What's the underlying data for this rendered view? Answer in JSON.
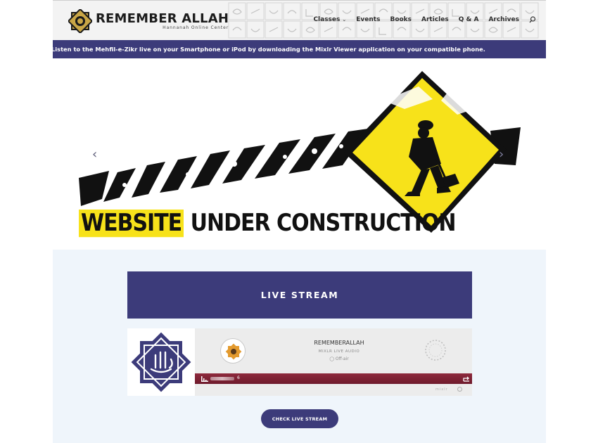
{
  "site": {
    "logo_title": "REMEMBER ALLAH",
    "logo_subtitle": "Hannanah Online Center"
  },
  "nav": {
    "items": [
      {
        "label": "Classes",
        "has_dropdown": true
      },
      {
        "label": "Events"
      },
      {
        "label": "Books"
      },
      {
        "label": "Articles"
      },
      {
        "label": "Q & A"
      },
      {
        "label": "Archives"
      }
    ],
    "search_icon": "search-icon"
  },
  "ticker": {
    "text": "Listen to the Mehfil-e-Zikr live on your Smartphone or iPod by downloading the Mixlr Viewer application on your compatible phone."
  },
  "slider": {
    "banner_highlight": "WEBSITE",
    "banner_rest": "UNDER CONSTRUCTION",
    "prev_icon": "chevron-left-icon",
    "next_icon": "chevron-right-icon"
  },
  "live": {
    "title": "LIVE STREAM",
    "player": {
      "name": "REMEMBERALLAH",
      "subtitle": "MIXLR LIVE AUDIO",
      "status": "Off-air",
      "listener_count": "6",
      "brand": "mixlr"
    },
    "cta_label": "CHECK LIVE STREAM"
  },
  "colors": {
    "primary": "#3c3b7a",
    "section_bg": "#eff5fb",
    "player_bar": "#8e2a3d",
    "sign_yellow": "#f7e21a"
  }
}
